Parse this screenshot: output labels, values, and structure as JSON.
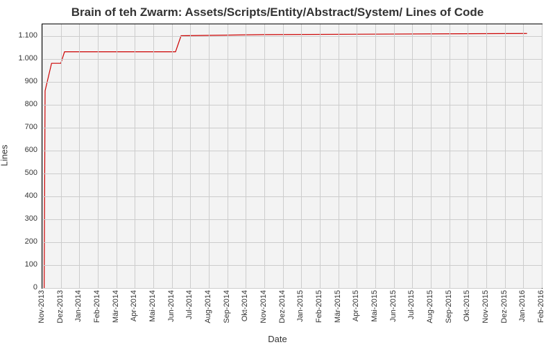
{
  "chart_data": {
    "type": "line",
    "title": "Brain of teh Zwarm: Assets/Scripts/Entity/Abstract/System/ Lines of Code",
    "xlabel": "Date",
    "ylabel": "Lines",
    "ylim": [
      0,
      1150
    ],
    "y_ticks": [
      0,
      100,
      200,
      300,
      400,
      500,
      600,
      700,
      800,
      900,
      1000,
      1100
    ],
    "y_tick_labels": [
      "0",
      "100",
      "200",
      "300",
      "400",
      "500",
      "600",
      "700",
      "800",
      "900",
      "1.000",
      "1.100"
    ],
    "x_tick_labels": [
      "Nov-2013",
      "Dez-2013",
      "Jan-2014",
      "Feb-2014",
      "Mär-2014",
      "Apr-2014",
      "Mai-2014",
      "Jun-2014",
      "Jul-2014",
      "Aug-2014",
      "Sep-2014",
      "Okt-2014",
      "Nov-2014",
      "Dez-2014",
      "Jan-2015",
      "Feb-2015",
      "Mär-2015",
      "Apr-2015",
      "Mai-2015",
      "Jun-2015",
      "Jul-2015",
      "Aug-2015",
      "Sep-2015",
      "Okt-2015",
      "Nov-2015",
      "Dez-2015",
      "Jan-2016",
      "Feb-2016"
    ],
    "x_tick_indices": [
      0,
      1,
      2,
      3,
      4,
      5,
      6,
      7,
      8,
      9,
      10,
      11,
      12,
      13,
      14,
      15,
      16,
      17,
      18,
      19,
      20,
      21,
      22,
      23,
      24,
      25,
      26,
      27
    ],
    "series": [
      {
        "name": "Lines of Code",
        "color": "#cc0000",
        "points": [
          {
            "x": 0.1,
            "y": 0
          },
          {
            "x": 0.15,
            "y": 860
          },
          {
            "x": 0.5,
            "y": 980
          },
          {
            "x": 1.0,
            "y": 980
          },
          {
            "x": 1.2,
            "y": 1030
          },
          {
            "x": 7.2,
            "y": 1030
          },
          {
            "x": 7.5,
            "y": 1100
          },
          {
            "x": 12.0,
            "y": 1105
          },
          {
            "x": 26.2,
            "y": 1110
          }
        ]
      }
    ]
  }
}
